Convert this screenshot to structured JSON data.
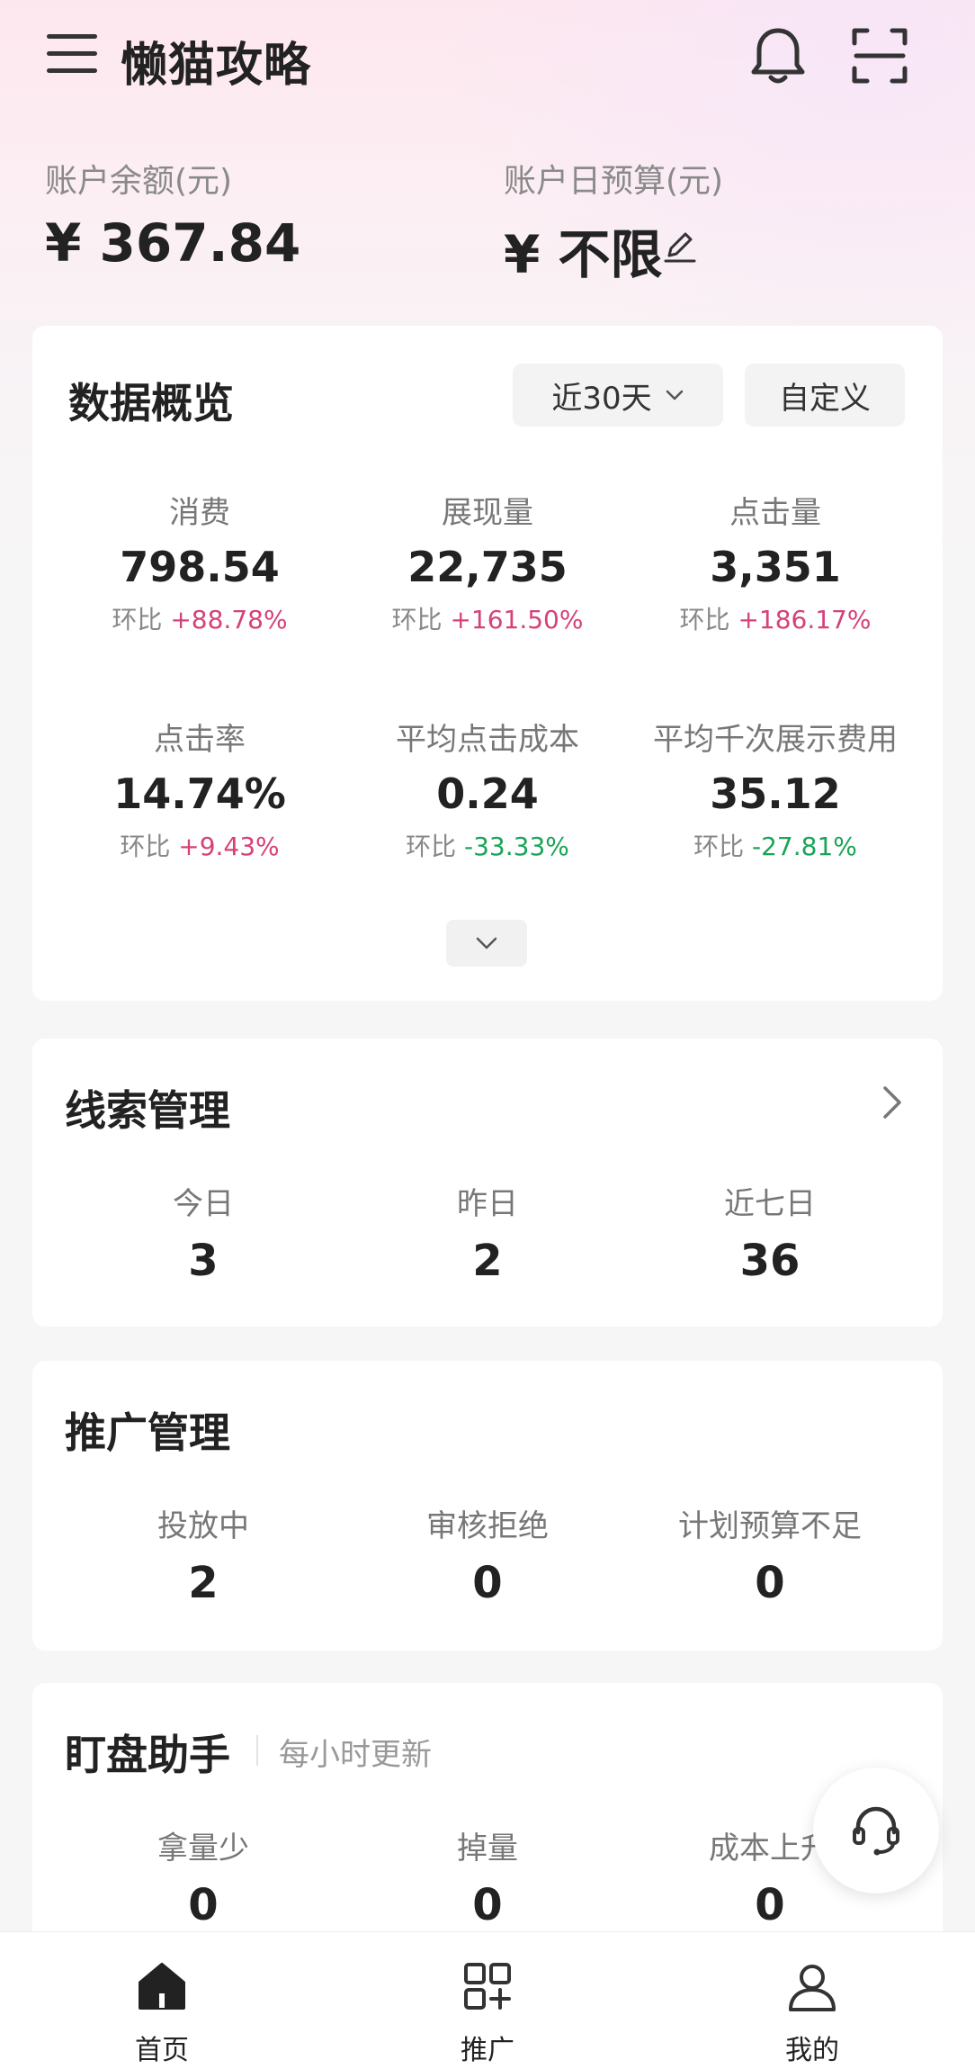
{
  "header": {
    "title": "懒猫攻略"
  },
  "account": {
    "balance_label": "账户余额(元)",
    "balance_value": "¥ 367.84",
    "budget_label": "账户日预算(元)",
    "budget_value": "¥ 不限"
  },
  "overview": {
    "title": "数据概览",
    "range_label": "近30天",
    "custom_label": "自定义",
    "metrics": [
      {
        "label": "消费",
        "value": "798.54",
        "cmp_label": "环比",
        "cmp": "+88.78%",
        "trend": "up"
      },
      {
        "label": "展现量",
        "value": "22,735",
        "cmp_label": "环比",
        "cmp": "+161.50%",
        "trend": "up"
      },
      {
        "label": "点击量",
        "value": "3,351",
        "cmp_label": "环比",
        "cmp": "+186.17%",
        "trend": "up"
      },
      {
        "label": "点击率",
        "value": "14.74%",
        "cmp_label": "环比",
        "cmp": "+9.43%",
        "trend": "up"
      },
      {
        "label": "平均点击成本",
        "value": "0.24",
        "cmp_label": "环比",
        "cmp": "-33.33%",
        "trend": "down"
      },
      {
        "label": "平均千次展示费用",
        "value": "35.12",
        "cmp_label": "环比",
        "cmp": "-27.81%",
        "trend": "down"
      }
    ]
  },
  "leads": {
    "title": "线索管理",
    "stats": [
      {
        "label": "今日",
        "value": "3"
      },
      {
        "label": "昨日",
        "value": "2"
      },
      {
        "label": "近七日",
        "value": "36"
      }
    ]
  },
  "promotion": {
    "title": "推广管理",
    "stats": [
      {
        "label": "投放中",
        "value": "2"
      },
      {
        "label": "审核拒绝",
        "value": "0"
      },
      {
        "label": "计划预算不足",
        "value": "0"
      }
    ]
  },
  "monitor": {
    "title": "盯盘助手",
    "note": "每小时更新",
    "stats": [
      {
        "label": "拿量少",
        "value": "0"
      },
      {
        "label": "掉量",
        "value": "0"
      },
      {
        "label": "成本上升",
        "value": "0"
      }
    ]
  },
  "nav": {
    "items": [
      {
        "label": "首页",
        "icon": "home-icon"
      },
      {
        "label": "推广",
        "icon": "apps-icon"
      },
      {
        "label": "我的",
        "icon": "user-icon"
      }
    ]
  },
  "colors": {
    "up": "#d6417a",
    "down": "#1aa457"
  }
}
